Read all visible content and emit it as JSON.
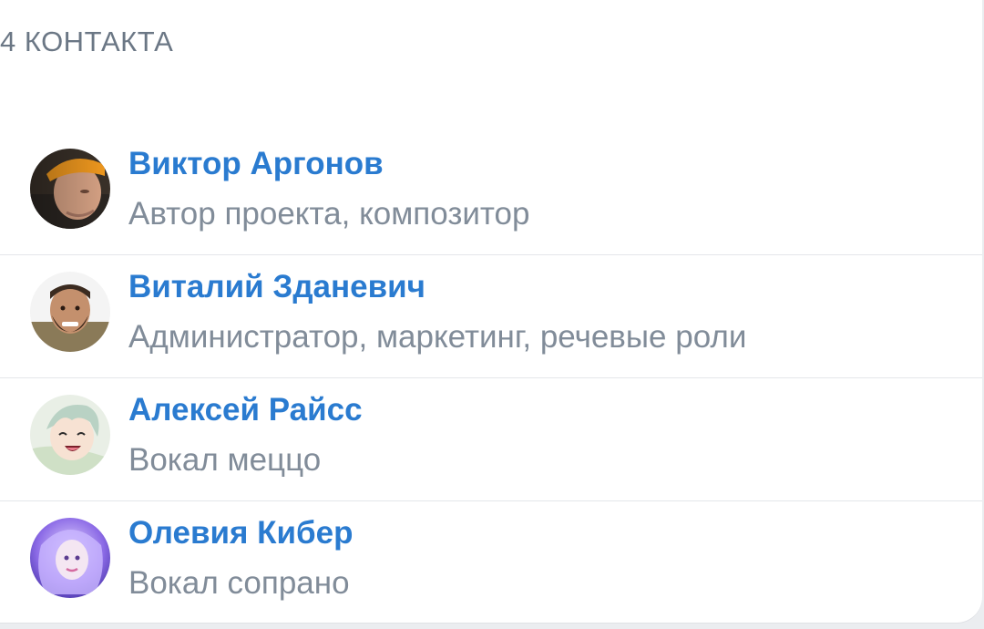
{
  "section": {
    "title": "4 КОНТАКТА"
  },
  "contacts": [
    {
      "name": "Виктор Аргонов",
      "role": "Автор проекта, композитор",
      "avatar_icon": "avatar-photo-man-orange-cap"
    },
    {
      "name": "Виталий Зданевич",
      "role": "Администратор, маркетинг, речевые роли",
      "avatar_icon": "avatar-photo-bearded-man"
    },
    {
      "name": "Алексей Райсс",
      "role": "Вокал меццо",
      "avatar_icon": "avatar-anime-character"
    },
    {
      "name": "Олевия Кибер",
      "role": "Вокал сопрано",
      "avatar_icon": "avatar-photo-woman-purple"
    }
  ],
  "colors": {
    "name_link": "#2a7bd0",
    "secondary_text": "#818c99",
    "header_text": "#6b7785",
    "divider": "#e4e6ea"
  }
}
